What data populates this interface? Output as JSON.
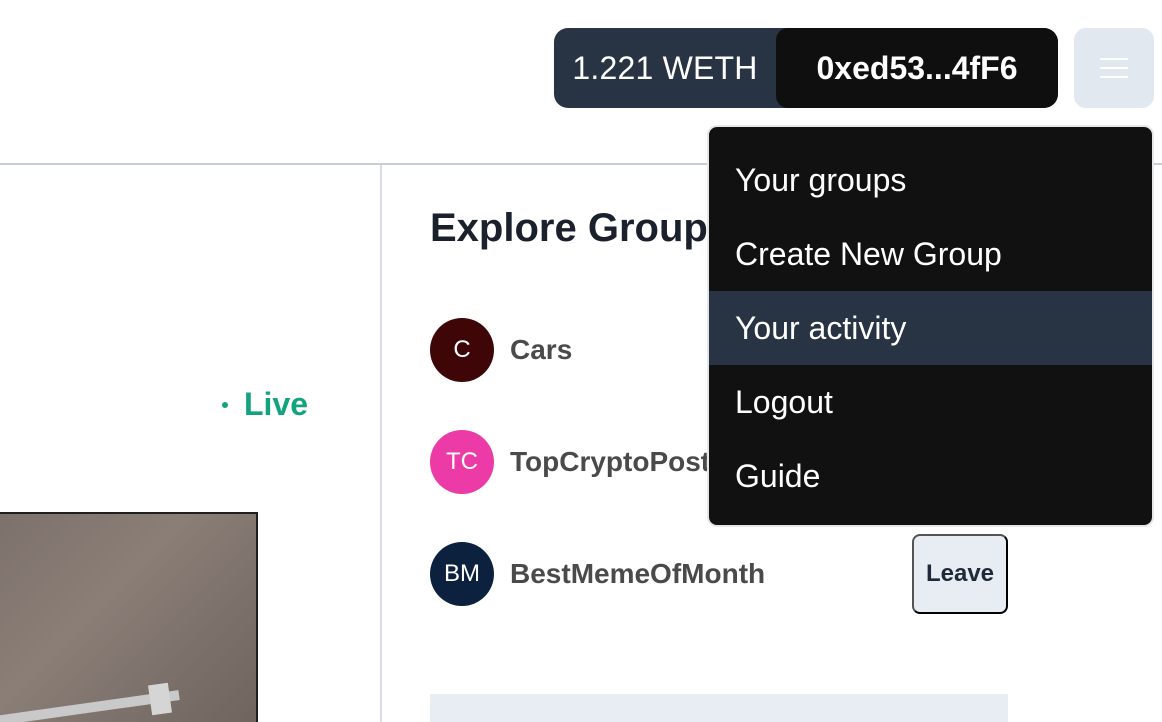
{
  "header": {
    "balance": "1.221 WETH",
    "address": "0xed53...4fF6",
    "menu_icon": "hamburger-icon"
  },
  "left": {
    "live_label": "Live"
  },
  "explore": {
    "title": "Explore Groups",
    "groups": [
      {
        "initials": "C",
        "name": "Cars",
        "color": "#3f0608"
      },
      {
        "initials": "TC",
        "name": "TopCryptoPosts",
        "color": "#ec3aa6"
      },
      {
        "initials": "BM",
        "name": "BestMemeOfMonth",
        "color": "#0c213d"
      }
    ],
    "leave_label": "Leave"
  },
  "dropdown": {
    "items": [
      {
        "label": "Your groups"
      },
      {
        "label": "Create New Group"
      },
      {
        "label": "Your activity"
      },
      {
        "label": "Logout"
      },
      {
        "label": "Guide"
      }
    ],
    "active_index": 2
  },
  "colors": {
    "live": "#14a37f",
    "wallet_bg": "#283343",
    "dropdown_bg": "#111111",
    "dropdown_active": "#283343"
  }
}
